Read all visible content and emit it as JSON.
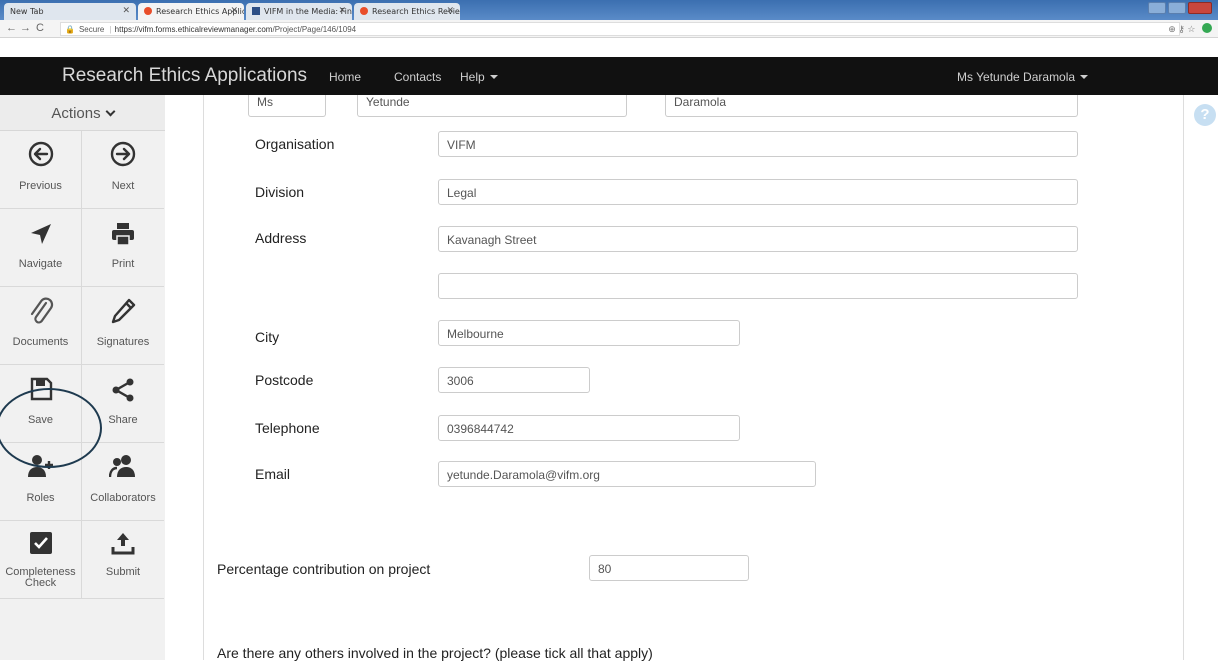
{
  "browser": {
    "tabs": [
      {
        "title": "New Tab"
      },
      {
        "title": "Research Ethics Applicat"
      },
      {
        "title": "VIFM in the Media: Find"
      },
      {
        "title": "Research Ethics Review"
      }
    ],
    "url_secure": "Secure",
    "url_host": "https://vifm.forms.ethicalreviewmanager.com",
    "url_path": "/Project/Page/146/1094"
  },
  "topnav": {
    "brand": "Research Ethics Applications",
    "home": "Home",
    "contacts": "Contacts",
    "help": "Help",
    "user": "Ms Yetunde Daramola"
  },
  "sidebar": {
    "header": "Actions",
    "items": [
      {
        "label": "Previous",
        "icon": "arrow-left-circle-icon"
      },
      {
        "label": "Next",
        "icon": "arrow-right-circle-icon"
      },
      {
        "label": "Navigate",
        "icon": "location-arrow-icon"
      },
      {
        "label": "Print",
        "icon": "printer-icon"
      },
      {
        "label": "Documents",
        "icon": "paperclip-icon"
      },
      {
        "label": "Signatures",
        "icon": "pencil-icon"
      },
      {
        "label": "Save",
        "icon": "floppy-disk-icon"
      },
      {
        "label": "Share",
        "icon": "share-icon"
      },
      {
        "label": "Roles",
        "icon": "user-plus-icon"
      },
      {
        "label": "Collaborators",
        "icon": "users-icon"
      },
      {
        "label": "Completeness\nCheck",
        "icon": "check-square-icon"
      },
      {
        "label": "Submit",
        "icon": "upload-icon"
      }
    ]
  },
  "form": {
    "title_value": "Ms",
    "first_name_value": "Yetunde",
    "last_name_value": "Daramola",
    "organisation_label": "Organisation",
    "organisation_value": "VIFM",
    "division_label": "Division",
    "division_value": "Legal",
    "address_label": "Address",
    "address_line1_value": "Kavanagh Street",
    "address_line2_value": "",
    "city_label": "City",
    "city_value": "Melbourne",
    "postcode_label": "Postcode",
    "postcode_value": "3006",
    "telephone_label": "Telephone",
    "telephone_value": "0396844742",
    "email_label": "Email",
    "email_value": "yetunde.Daramola@vifm.org",
    "percentage_label": "Percentage contribution on project",
    "percentage_value": "80",
    "others_question": "Are there any others involved in the project? (please tick all that apply)"
  },
  "help_icon": "?"
}
